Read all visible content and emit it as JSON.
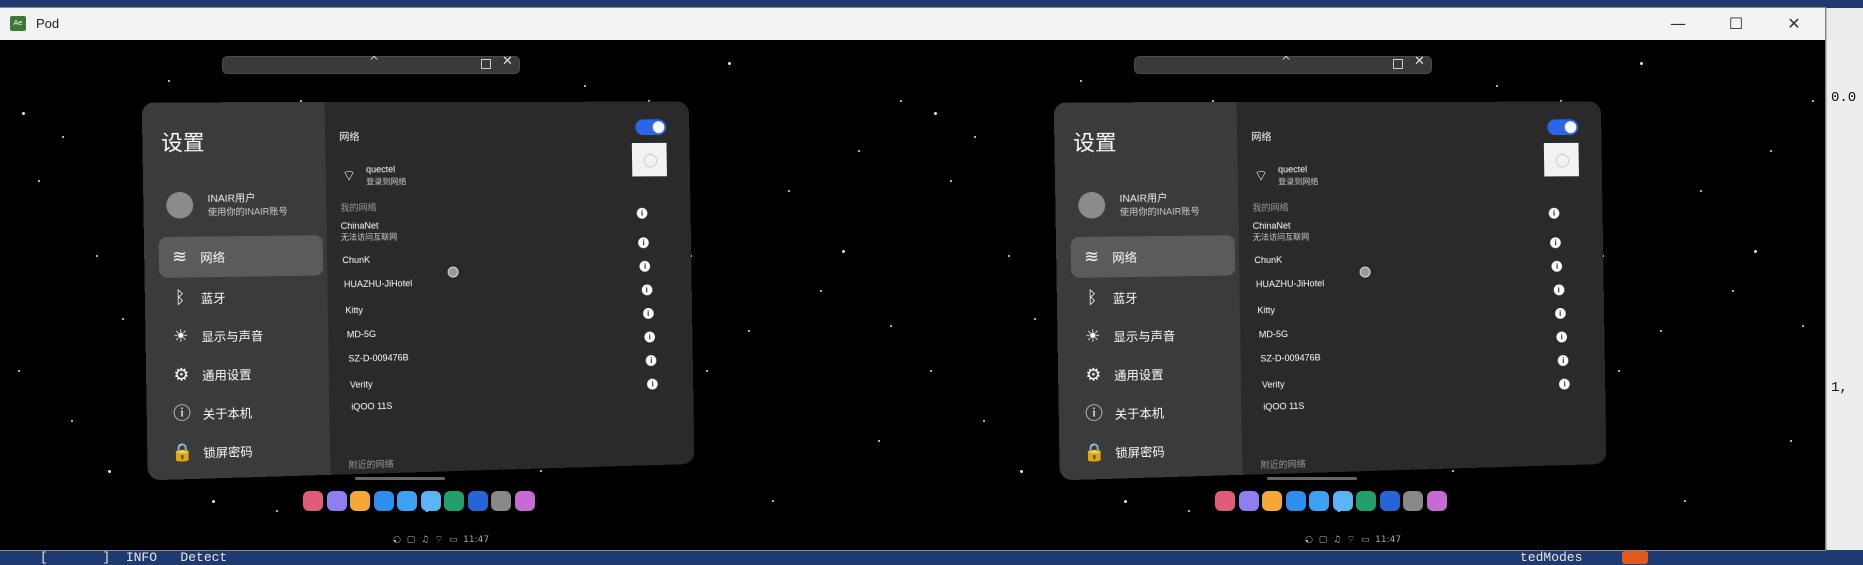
{
  "window": {
    "title": "Pod",
    "app_icon_label": "Ae",
    "controls": {
      "minimize": "—",
      "maximize": "☐",
      "close": "✕"
    }
  },
  "ide": {
    "bottom_text_left": "[       ]  INFO   Detect",
    "bottom_text_right": "tedModes",
    "right_text_1": "0.0",
    "right_text_2": "1,"
  },
  "settings": {
    "title": "设置",
    "account": {
      "name": "INAIR用户",
      "subtitle": "使用你的INAIR账号"
    },
    "menu": [
      {
        "label": "网络",
        "icon": "wifi-icon",
        "active": true
      },
      {
        "label": "蓝牙",
        "icon": "bluetooth-icon",
        "active": false
      },
      {
        "label": "显示与声音",
        "icon": "brightness-icon",
        "active": false
      },
      {
        "label": "通用设置",
        "icon": "gear-icon",
        "active": false
      },
      {
        "label": "关于本机",
        "icon": "info-icon",
        "active": false
      },
      {
        "label": "锁屏密码",
        "icon": "lock-icon",
        "active": false
      }
    ],
    "network": {
      "section_title": "网络",
      "toggle_on": true,
      "connected": {
        "name": "quectel",
        "status": "登录到网络"
      },
      "my_networks_label": "我的网络",
      "my_networks": [
        {
          "name": "ChinaNet",
          "status": "无法访问互联网"
        },
        {
          "name": "ChunK",
          "status": ""
        },
        {
          "name": "HUAZHU-JiHotel",
          "status": ""
        },
        {
          "name": "Kitty",
          "status": ""
        },
        {
          "name": "MD-5G",
          "status": ""
        },
        {
          "name": "SZ-D-009476B",
          "status": ""
        },
        {
          "name": "Verity",
          "status": ""
        },
        {
          "name": "iQOO 11S",
          "status": ""
        }
      ],
      "nearby_label": "附近的网络"
    }
  },
  "statusbar": {
    "time": "11:47"
  },
  "colors": {
    "toggle_accent": "#2a66e8",
    "ide_background": "#1e3a6e"
  }
}
